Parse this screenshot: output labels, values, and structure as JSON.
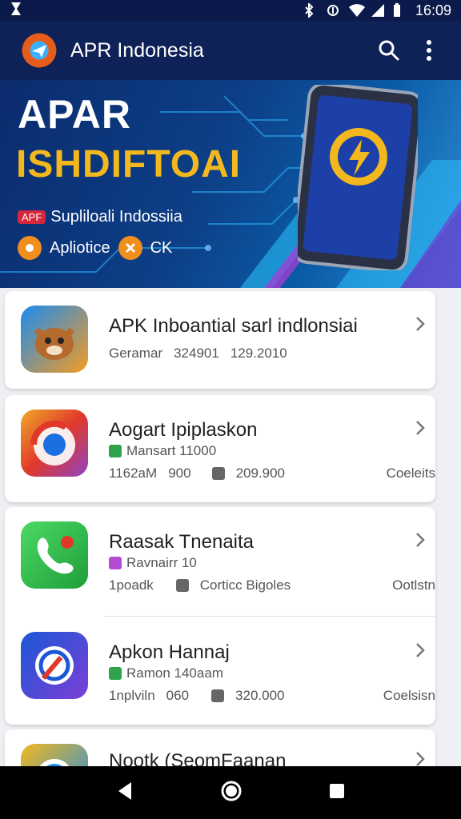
{
  "status_bar": {
    "time": "16:09"
  },
  "app_bar": {
    "title": "APR Indonesia",
    "search_icon": "search-icon",
    "more_icon": "more-vert-icon"
  },
  "banner": {
    "title_line1": "APAR",
    "title_line2": "ISHDIFTOAI",
    "badge": "APF",
    "subtitle": "Supliloali Indossiia",
    "feature1": "Apliotice",
    "feature2": "CK",
    "colors": {
      "accent": "#f3b81d",
      "badge": "#d6263c",
      "feature": "#f08f1b"
    }
  },
  "apps": [
    {
      "name": "APK Inboantial sarl indlonsiai",
      "meta": [
        "Geramar",
        "324901",
        "129.2010"
      ]
    },
    {
      "name": "Aogart Ipiplaskon",
      "sub": "Mansart 11000",
      "meta": [
        "1162aM",
        "900",
        "209.900"
      ],
      "meta_right": "Coeleits"
    },
    {
      "name": "Raasak Tnenaita",
      "sub": "Ravnairr 10",
      "meta": [
        "1poadk",
        "Corticc Bigoles"
      ],
      "meta_right": "Ootlstn"
    },
    {
      "name": "Apkon Hannaj",
      "sub": "Ramon 140aam",
      "meta": [
        "1nplviln",
        "060",
        "320.000"
      ],
      "meta_right": "Coelsisn"
    },
    {
      "name": "Nootk (SeomFaanan"
    }
  ]
}
